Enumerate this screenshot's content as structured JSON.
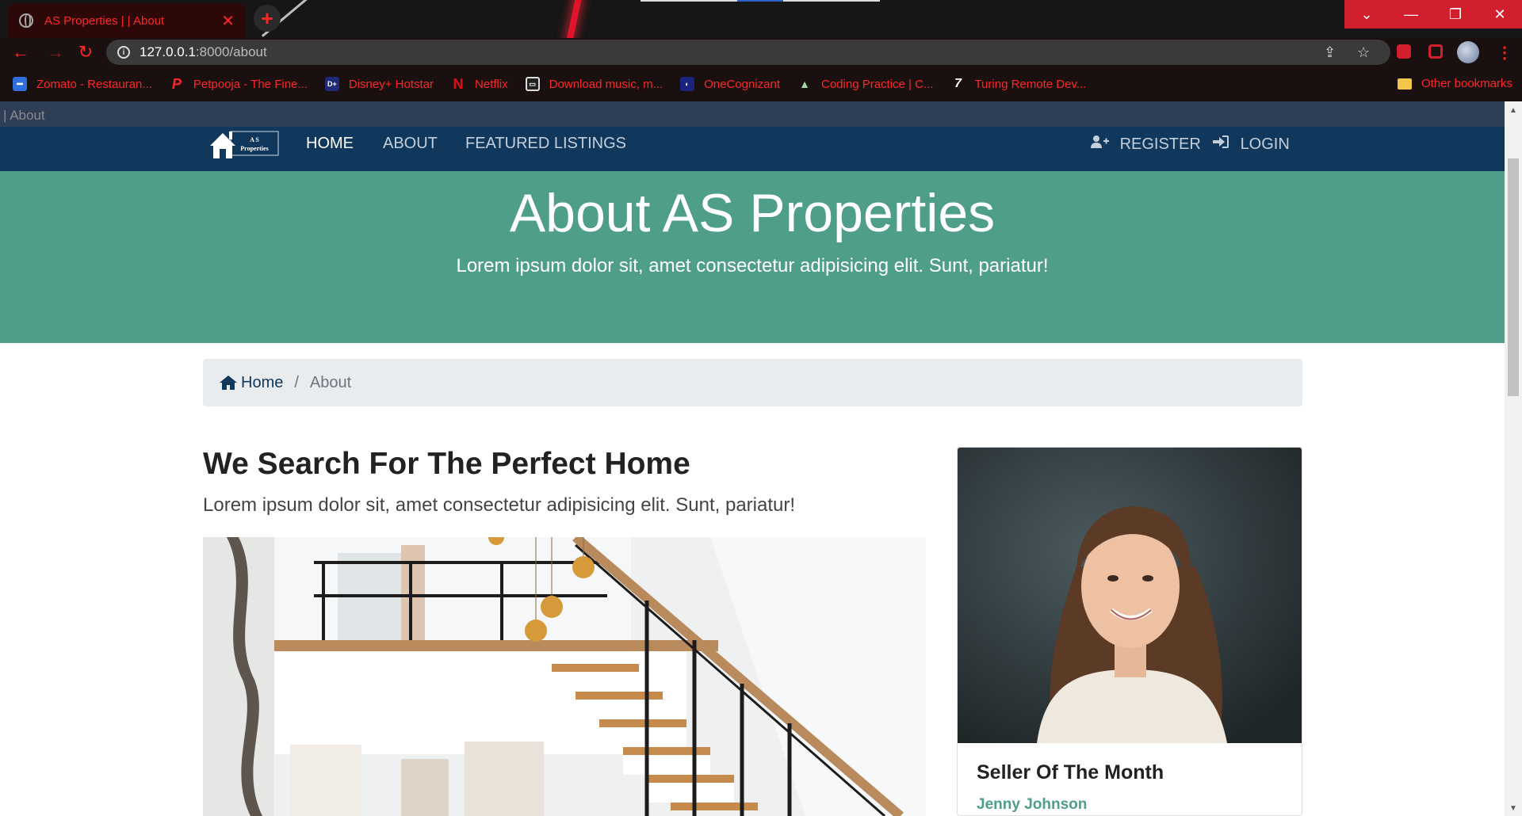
{
  "browser": {
    "tab_title": "AS Properties | | About",
    "tab_close": "✕",
    "new_tab": "+",
    "window_controls": [
      "⌄",
      "—",
      "❐",
      "✕"
    ],
    "url_host": "127.0.0.1",
    "url_path": ":8000/about",
    "bookmarks": [
      {
        "label": "Zomato - Restauran...",
        "icon": "zomato-icon",
        "color": "#2f6fdc"
      },
      {
        "label": "Petpooja - The Fine...",
        "icon": "petpooja-icon",
        "color": "#ff2626"
      },
      {
        "label": "Disney+ Hotstar",
        "icon": "hotstar-icon",
        "color": "#1e2a78"
      },
      {
        "label": "Netflix",
        "icon": "netflix-icon",
        "color": "#e50914"
      },
      {
        "label": "Download music, m...",
        "icon": "music-icon",
        "color": "#333333"
      },
      {
        "label": "OneCognizant",
        "icon": "cognizant-icon",
        "color": "#1a237e"
      },
      {
        "label": "Coding Practice | C...",
        "icon": "coding-icon",
        "color": "#2e7d32"
      },
      {
        "label": "Turing Remote Dev...",
        "icon": "turing-icon",
        "color": "#111111"
      }
    ],
    "other_bookmarks": "Other bookmarks"
  },
  "page": {
    "top_strip_text": "| About",
    "nav": {
      "logo_line1": "A S",
      "logo_line2": "Properties",
      "links": [
        "HOME",
        "ABOUT",
        "FEATURED LISTINGS"
      ],
      "register": "REGISTER",
      "login": "LOGIN"
    },
    "showcase": {
      "title": "About AS Properties",
      "lead": "Lorem ipsum dolor sit, amet consectetur adipisicing elit. Sunt, pariatur!"
    },
    "breadcrumb": {
      "home": "Home",
      "separator": "/",
      "current": "About"
    },
    "about": {
      "title": "We Search For The Perfect Home",
      "lead": "Lorem ipsum dolor sit, amet consectetur adipisicing elit. Sunt, pariatur!"
    },
    "seller": {
      "title": "Seller Of The Month",
      "name": "Jenny Johnson"
    },
    "colors": {
      "nav_bg": "#10375c",
      "showcase_bg": "#4f9e8a",
      "accent": "#4f9e8a",
      "browser_accent": "#ff2626"
    }
  }
}
